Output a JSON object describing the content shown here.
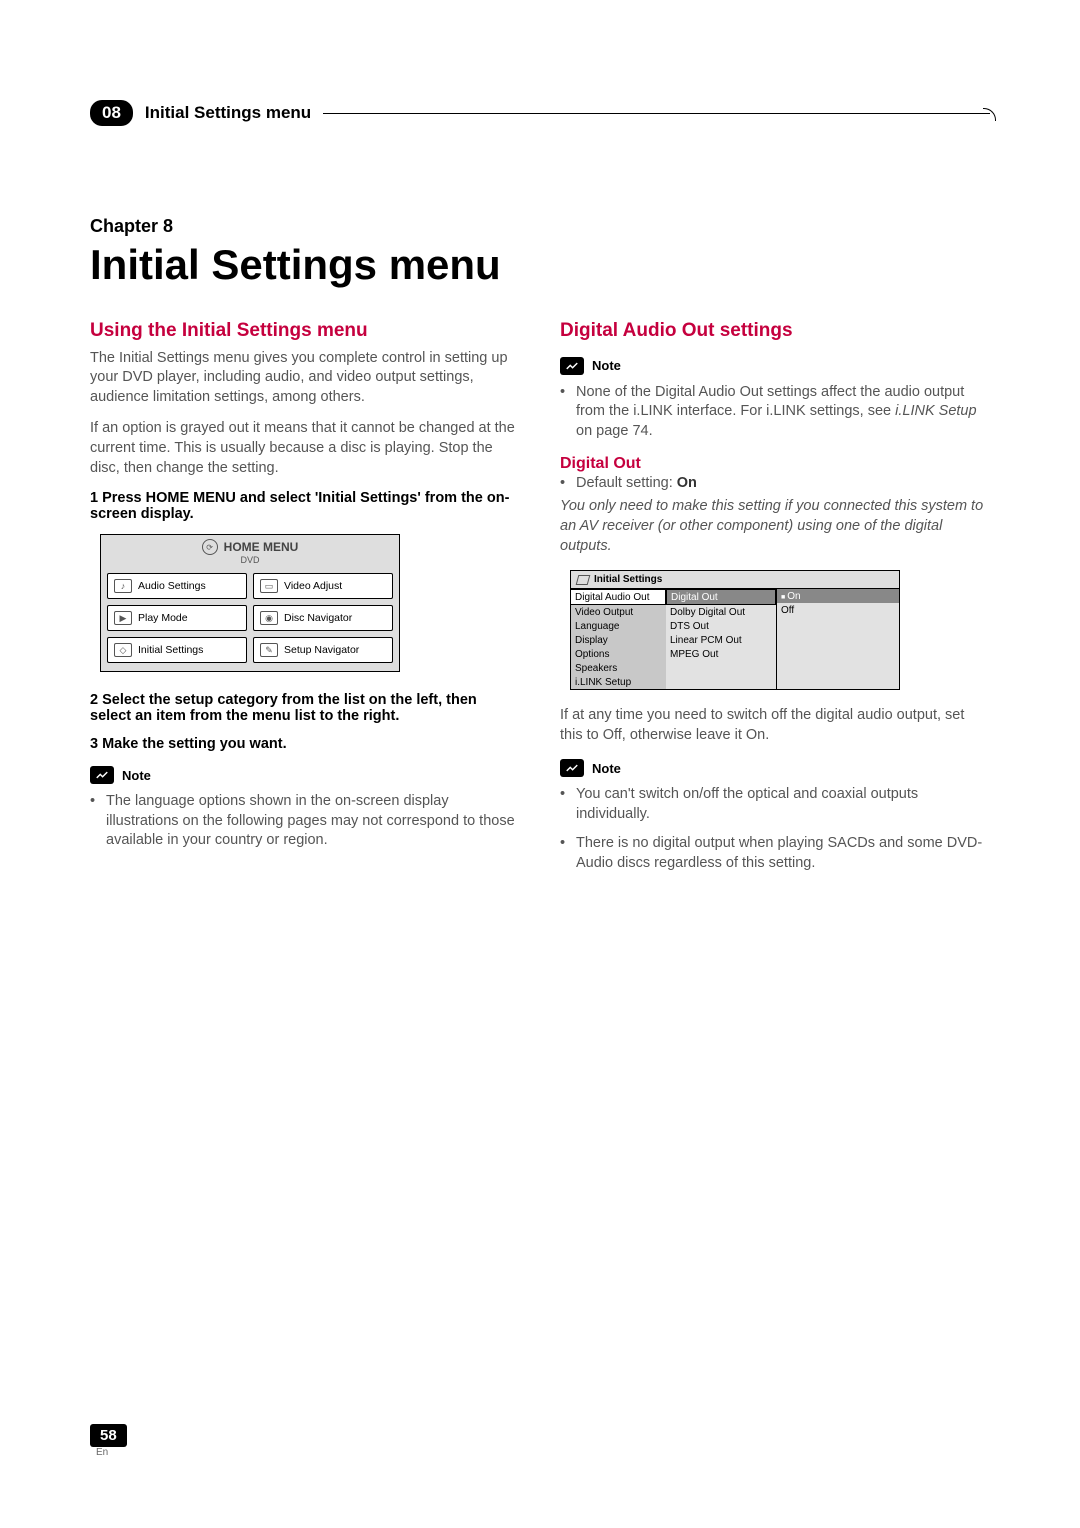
{
  "header": {
    "section_no": "08",
    "section_title": "Initial Settings menu"
  },
  "chapter": {
    "label": "Chapter 8",
    "title": "Initial Settings menu"
  },
  "left": {
    "heading": "Using the Initial Settings menu",
    "para1": "The Initial Settings menu gives you complete control in setting up your DVD player, including audio, and video output settings, audience limitation settings, among others.",
    "para2": "If an option is grayed out it means that it cannot be changed at the current time. This is usually because a disc is playing. Stop the disc, then change the setting.",
    "step1": "1    Press HOME MENU and select 'Initial Settings' from the on-screen display.",
    "home_menu": {
      "title": "HOME MENU",
      "sub": "DVD",
      "items": [
        "Audio Settings",
        "Video Adjust",
        "Play Mode",
        "Disc Navigator",
        "Initial Settings",
        "Setup Navigator"
      ]
    },
    "step2": "2    Select the setup category from the list on the left, then select an item from the menu list to the right.",
    "step3": "3    Make the setting you want.",
    "note_label": "Note",
    "note_bullet": "The language options shown in the on-screen display illustrations on the following pages may not correspond to those available in your country or region."
  },
  "right": {
    "heading": "Digital Audio Out settings",
    "note_label": "Note",
    "note_bullet1_a": "None of the Digital Audio Out settings affect the audio output from the i.LINK interface. For i.LINK settings, see ",
    "note_bullet1_b": "i.LINK Setup",
    "note_bullet1_c": " on page 74.",
    "sub_heading": "Digital Out",
    "default_prefix": "Default setting: ",
    "default_value": "On",
    "italic": "You only need to make this setting if you connected this system to an AV receiver (or other component) using one of the digital outputs.",
    "settings_mock": {
      "title": "Initial Settings",
      "left_items": [
        "Digital Audio Out",
        "Video Output",
        "Language",
        "Display",
        "Options",
        "Speakers",
        "i.LINK Setup"
      ],
      "mid_items": [
        "Digital Out",
        "Dolby Digital Out",
        "DTS Out",
        "Linear PCM Out",
        "MPEG Out"
      ],
      "right_items": [
        "On",
        "Off"
      ]
    },
    "para_after": "If at any time you need to switch off the digital audio output, set this to Off, otherwise leave it On.",
    "note2_label": "Note",
    "note2_bullet1": "You can't switch on/off the optical and coaxial outputs individually.",
    "note2_bullet2": "There is no digital output when playing SACDs and some DVD-Audio discs regardless of this setting."
  },
  "footer": {
    "page": "58",
    "lang": "En"
  }
}
